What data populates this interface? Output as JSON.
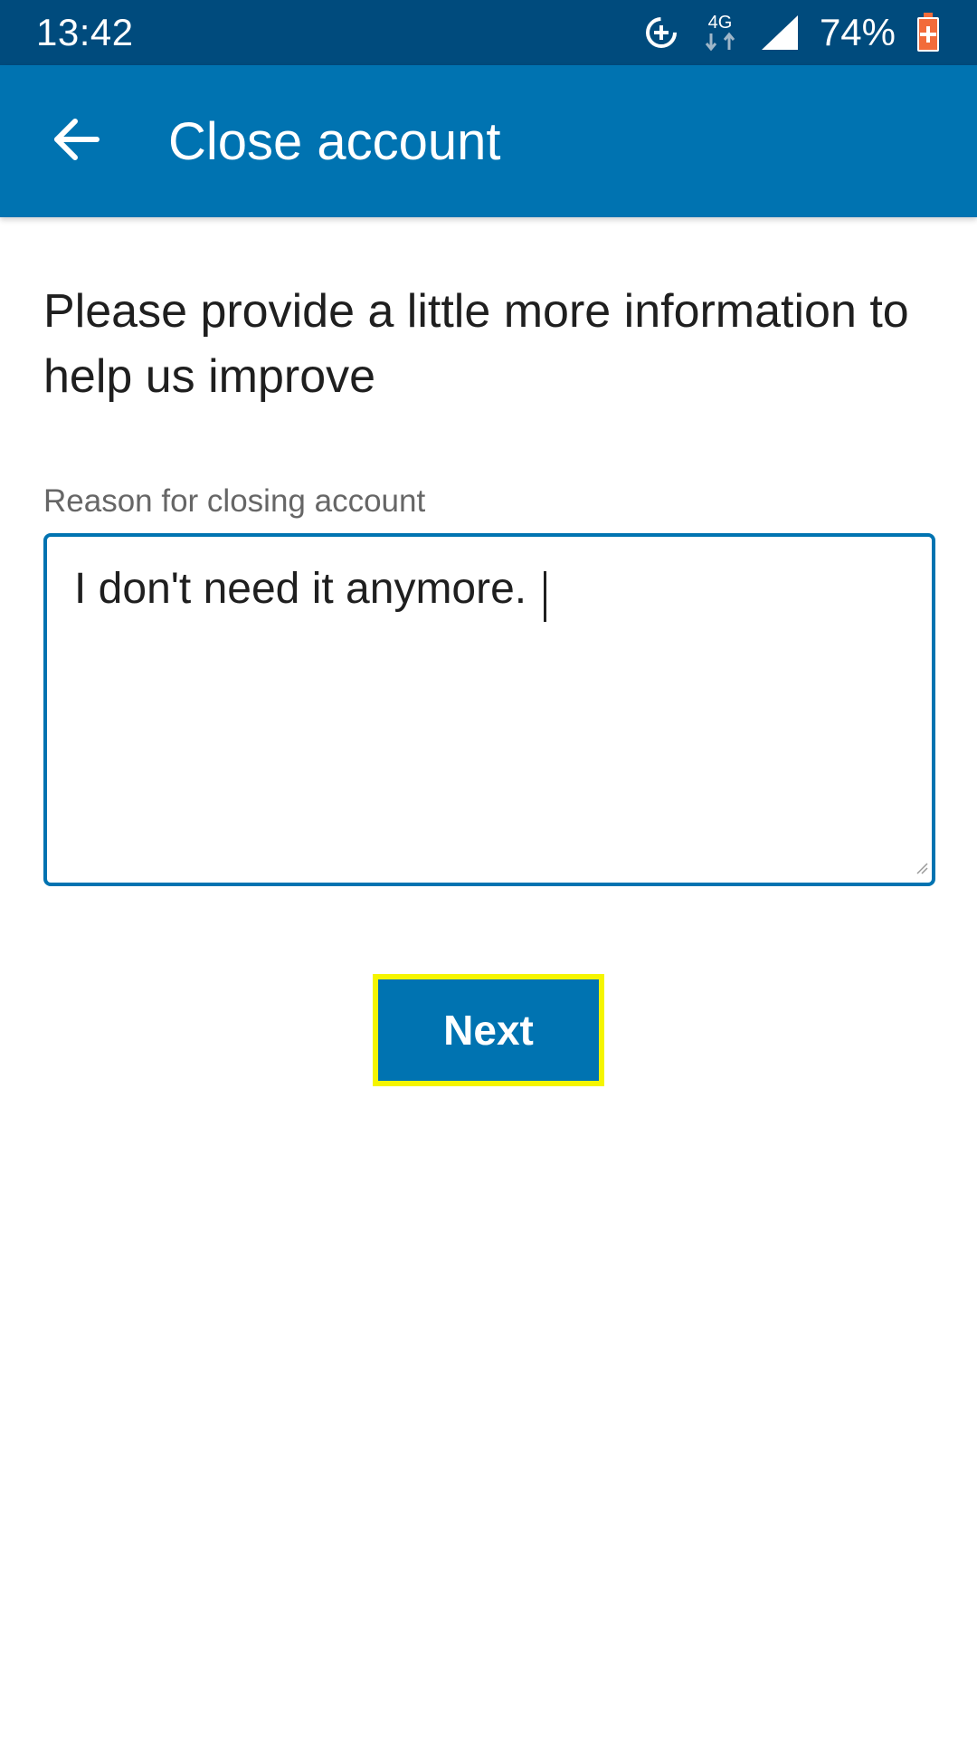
{
  "status_bar": {
    "time": "13:42",
    "network_label": "4G",
    "battery": "74%",
    "icons": [
      "data-saver-icon",
      "network-4g-icon",
      "signal-icon",
      "battery-charging-icon"
    ]
  },
  "app_bar": {
    "title": "Close account",
    "back_icon": "arrow-left-icon"
  },
  "form": {
    "instruction": "Please provide a little more information to help us improve",
    "reason_label": "Reason for closing account",
    "reason_value": "I don't need it anymore. "
  },
  "actions": {
    "next_label": "Next"
  },
  "colors": {
    "status_bar": "#004b7d",
    "primary": "#0073b1",
    "highlight": "#f5f500",
    "battery_accent": "#f26b3a"
  }
}
